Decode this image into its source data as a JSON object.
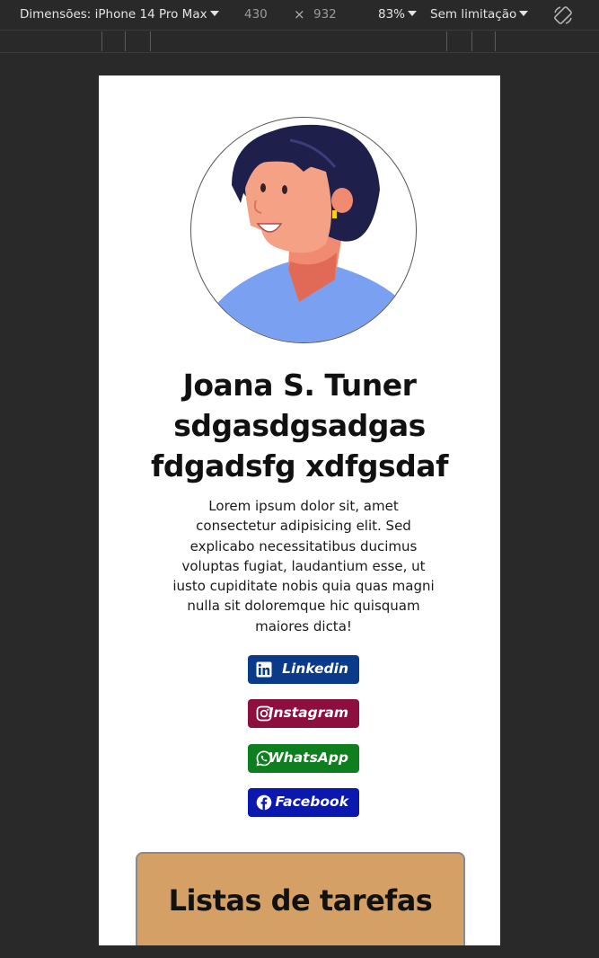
{
  "devtools": {
    "dimensions_label": "Dimensões: iPhone 14 Pro Max",
    "width": "430",
    "times": "×",
    "height": "932",
    "zoom": "83%",
    "throttle": "Sem limitação",
    "rotate_icon": "rotate-icon"
  },
  "profile": {
    "name": "Joana S. Tuner sdgasdgsadgas fdgadsfg xdfgsdaf",
    "bio": "Lorem ipsum dolor sit, amet consectetur adipisicing elit. Sed explicabo necessitatibus ducimus voluptas fugiat, laudantium esse, ut iusto cupiditate nobis quia quas magni nulla sit doloremque hic quisquam maiores dicta!"
  },
  "social": [
    {
      "label": "Linkedin",
      "icon": "linkedin-icon",
      "color": "#0a3a8a"
    },
    {
      "label": "Instagram",
      "icon": "instagram-icon",
      "color": "#8c0f3d"
    },
    {
      "label": "WhatsApp",
      "icon": "whatsapp-icon",
      "color": "#0e7f1e"
    },
    {
      "label": "Facebook",
      "icon": "facebook-icon",
      "color": "#0b18b0"
    }
  ],
  "tasks": {
    "title": "Listas de tarefas",
    "color": "#d4a066"
  }
}
